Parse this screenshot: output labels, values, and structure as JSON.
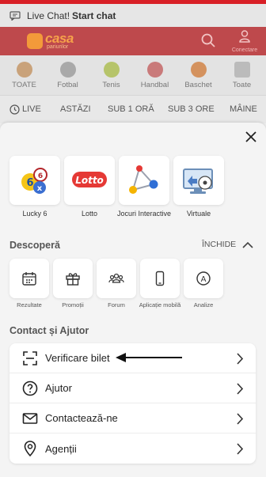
{
  "livechat": {
    "prefix": "Live Chat!",
    "action": "Start chat"
  },
  "header": {
    "logo_text": "casa",
    "logo_sub": "pariurilor",
    "account_label": "Conectare"
  },
  "sports": [
    {
      "label": "TOATE",
      "color": "#c9a27a"
    },
    {
      "label": "Fotbal",
      "color": "#a9a9a9"
    },
    {
      "label": "Tenis",
      "color": "#b6c46a"
    },
    {
      "label": "Handbal",
      "color": "#c97a7a"
    },
    {
      "label": "Baschet",
      "color": "#d4925e"
    },
    {
      "label": "Toate",
      "color": "#bbbbbb"
    }
  ],
  "tabs": [
    "LIVE",
    "ASTĂZI",
    "SUB 1 ORĂ",
    "SUB 3 ORE",
    "MÂINE"
  ],
  "games": [
    {
      "label": "Lucky 6"
    },
    {
      "label": "Lotto"
    },
    {
      "label": "Jocuri Interactive"
    },
    {
      "label": "Virtuale"
    }
  ],
  "descopera": {
    "title": "Descoperă",
    "toggle_label": "ÎNCHIDE",
    "items": [
      {
        "label": "Rezultate",
        "icon": "calendar-icon"
      },
      {
        "label": "Promoții",
        "icon": "gift-icon"
      },
      {
        "label": "Forum",
        "icon": "people-icon"
      },
      {
        "label": "Aplicație mobilă",
        "icon": "smartphone-icon"
      },
      {
        "label": "Analize",
        "icon": "analysis-icon"
      }
    ]
  },
  "contact": {
    "title": "Contact și Ajutor",
    "items": [
      {
        "label": "Verificare bilet",
        "icon": "scan-icon"
      },
      {
        "label": "Ajutor",
        "icon": "help-icon"
      },
      {
        "label": "Contactează-ne",
        "icon": "mail-icon"
      },
      {
        "label": "Agenții",
        "icon": "location-pin-icon"
      }
    ]
  },
  "colors": {
    "brand_red": "#d81f26",
    "accent_orange": "#f39a3a"
  }
}
